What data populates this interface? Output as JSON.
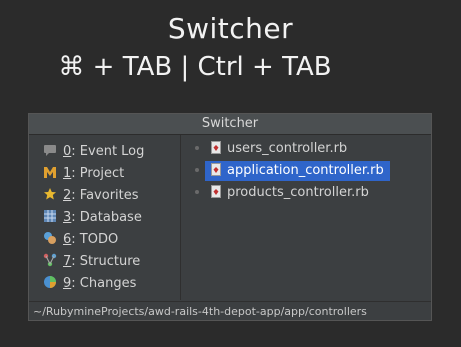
{
  "slide": {
    "title": "Switcher",
    "shortcut": "⌘ + TAB | Ctrl + TAB"
  },
  "switcher": {
    "title": "Switcher",
    "tool_windows": [
      {
        "num": "0",
        "label": ": Event Log",
        "icon": "event-log-icon"
      },
      {
        "num": "1",
        "label": ": Project",
        "icon": "project-icon"
      },
      {
        "num": "2",
        "label": ": Favorites",
        "icon": "favorites-icon"
      },
      {
        "num": "3",
        "label": ": Database",
        "icon": "database-icon"
      },
      {
        "num": "6",
        "label": ": TODO",
        "icon": "todo-icon"
      },
      {
        "num": "7",
        "label": ": Structure",
        "icon": "structure-icon"
      },
      {
        "num": "9",
        "label": ": Changes",
        "icon": "changes-icon"
      }
    ],
    "files": [
      {
        "name": "users_controller.rb",
        "selected": false
      },
      {
        "name": "application_controller.rb",
        "selected": true
      },
      {
        "name": "products_controller.rb",
        "selected": false
      }
    ],
    "path": "~/RubymineProjects/awd-rails-4th-depot-app/app/controllers",
    "colors": {
      "selection": "#2f65ca",
      "background": "#3c3f41"
    }
  }
}
